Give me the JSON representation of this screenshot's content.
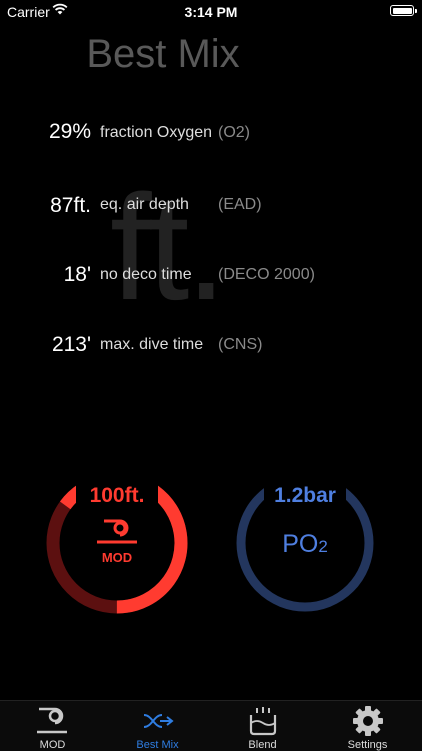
{
  "status": {
    "carrier": "Carrier",
    "time": "3:14 PM"
  },
  "header": {
    "title": "Best Mix",
    "watermark": "ft."
  },
  "rows": [
    {
      "value": "29%",
      "label": "fraction Oxygen",
      "abbr": "(O2)"
    },
    {
      "value": "87ft.",
      "label": "eq. air depth",
      "abbr": "(EAD)"
    },
    {
      "value": "18'",
      "label": "no deco time",
      "abbr": "(DECO 2000)"
    },
    {
      "value": "213'",
      "label": "max. dive time",
      "abbr": "(CNS)"
    }
  ],
  "gauges": {
    "mod": {
      "value": "100ft.",
      "label": "MOD",
      "color": "#ff3b30",
      "fill_fraction": 0.65
    },
    "po2": {
      "value": "1.2bar",
      "label_main": "PO",
      "label_sub": "2",
      "color": "#4f7fe0"
    }
  },
  "tabs": [
    {
      "label": "MOD",
      "icon": "diver-flag-icon"
    },
    {
      "label": "Best Mix",
      "icon": "mix-arrow-icon",
      "active": true
    },
    {
      "label": "Blend",
      "icon": "tank-blend-icon"
    },
    {
      "label": "Settings",
      "icon": "gear-icon"
    }
  ],
  "colors": {
    "active_tab": "#2f7de1",
    "accent_red": "#ff3b30",
    "accent_blue": "#4f7fe0"
  }
}
